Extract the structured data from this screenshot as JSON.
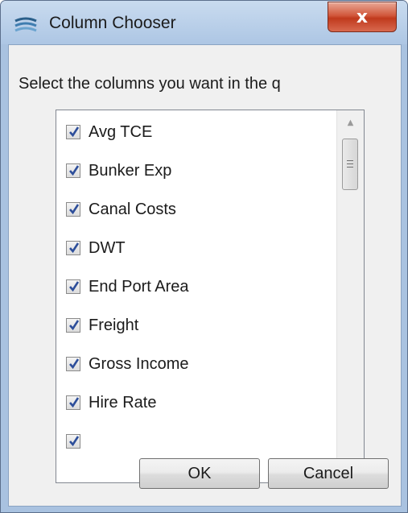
{
  "window": {
    "title": "Column Chooser",
    "close_label": "x"
  },
  "instruction": "Select the columns you want in the q",
  "columns": [
    {
      "label": "Avg TCE",
      "checked": true
    },
    {
      "label": "Bunker Exp",
      "checked": true
    },
    {
      "label": "Canal Costs",
      "checked": true
    },
    {
      "label": "DWT",
      "checked": true
    },
    {
      "label": "End Port Area",
      "checked": true
    },
    {
      "label": "Freight",
      "checked": true
    },
    {
      "label": "Gross Income",
      "checked": true
    },
    {
      "label": "Hire Rate",
      "checked": true
    },
    {
      "label": "",
      "checked": true
    }
  ],
  "buttons": {
    "ok": "OK",
    "cancel": "Cancel"
  },
  "icons": {
    "app": "app-logo-icon",
    "close": "close-icon",
    "check": "checkmark-icon",
    "scroll_up": "scroll-up-icon",
    "scroll_down": "scroll-down-icon"
  },
  "colors": {
    "frame": "#a9c2e0",
    "close_button": "#c03a1d",
    "check": "#2d4e9a"
  }
}
